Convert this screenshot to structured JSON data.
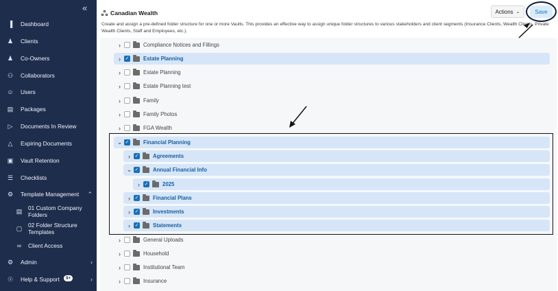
{
  "sidebar": {
    "collapse_icon": "double-chevron-left",
    "items": [
      {
        "label": "Dashboard",
        "icon": "chart-icon",
        "glyph": "▐"
      },
      {
        "label": "Clients",
        "icon": "users-icon",
        "glyph": "♟"
      },
      {
        "label": "Co-Owners",
        "icon": "co-owners-icon",
        "glyph": "♟"
      },
      {
        "label": "Collaborators",
        "icon": "collaborators-icon",
        "glyph": "⚇"
      },
      {
        "label": "Users",
        "icon": "user-icon",
        "glyph": "☺"
      },
      {
        "label": "Packages",
        "icon": "package-icon",
        "glyph": "▤"
      },
      {
        "label": "Documents In Review",
        "icon": "document-review-icon",
        "glyph": "▷"
      },
      {
        "label": "Expiring Documents",
        "icon": "expiring-document-icon",
        "glyph": "△"
      },
      {
        "label": "Vault Retention",
        "icon": "vault-icon",
        "glyph": "▣"
      },
      {
        "label": "Checklists",
        "icon": "checklist-icon",
        "glyph": "☰"
      },
      {
        "label": "Template Management",
        "icon": "template-icon",
        "glyph": "⚙"
      },
      {
        "label": "01 Custom Company Folders",
        "icon": "folder-icon",
        "glyph": "▤"
      },
      {
        "label": "02 Folder Structure Templates",
        "icon": "folder-icon",
        "glyph": "□"
      },
      {
        "label": "Client Access",
        "icon": "link-icon",
        "glyph": "∞"
      },
      {
        "label": "Admin",
        "icon": "admin-icon",
        "glyph": "⚙"
      },
      {
        "label": "Help & Support",
        "icon": "help-icon",
        "glyph": "☉",
        "badge": "9+"
      }
    ]
  },
  "header": {
    "title": "Canadian Wealth",
    "description": "Create and assign a pre-defined folder structure for one or more Vaults. This provides an effective way to assign unique folder structures to various stakeholders and client segments (Insurance Clients, Wealth Clients, Private Wealth Clients, Staff and Employees, etc.).",
    "actions_label": "Actions",
    "save_label": "Save"
  },
  "tree": [
    {
      "name": "Compliance Notices and Fillings",
      "checked": false,
      "selected": false,
      "expanded": false
    },
    {
      "name": "Estate Planning",
      "checked": true,
      "selected": true,
      "expanded": false
    },
    {
      "name": "Estate Planning",
      "checked": false,
      "selected": false,
      "expanded": false
    },
    {
      "name": "Estate Planning test",
      "checked": false,
      "selected": false,
      "expanded": false
    },
    {
      "name": "Family",
      "checked": false,
      "selected": false,
      "expanded": false
    },
    {
      "name": "Family Photos",
      "checked": false,
      "selected": false,
      "expanded": false
    },
    {
      "name": "FGA Wealth",
      "checked": false,
      "selected": false,
      "expanded": false
    },
    {
      "name": "Financial Planning",
      "checked": true,
      "selected": true,
      "expanded": true
    },
    {
      "name": "Agreements",
      "checked": true,
      "selected": true,
      "expanded": false
    },
    {
      "name": "Annual Financial Info",
      "checked": true,
      "selected": true,
      "expanded": true
    },
    {
      "name": "2025",
      "checked": true,
      "selected": true,
      "expanded": false
    },
    {
      "name": "Financial Plans",
      "checked": true,
      "selected": true,
      "expanded": false
    },
    {
      "name": "Investments",
      "checked": true,
      "selected": true,
      "expanded": false
    },
    {
      "name": "Statements",
      "checked": true,
      "selected": true,
      "expanded": false
    },
    {
      "name": "General Uploads",
      "checked": false,
      "selected": false,
      "expanded": false
    },
    {
      "name": "Household",
      "checked": false,
      "selected": false,
      "expanded": false
    },
    {
      "name": "Institutional Team",
      "checked": false,
      "selected": false,
      "expanded": false
    },
    {
      "name": "Insurance",
      "checked": false,
      "selected": false,
      "expanded": false
    }
  ],
  "colors": {
    "sidebar_bg": "#1f2d4d",
    "selected_row_bg": "#d6e6f8",
    "accent": "#1a6fb8",
    "save_bg": "#d9ecfb"
  }
}
